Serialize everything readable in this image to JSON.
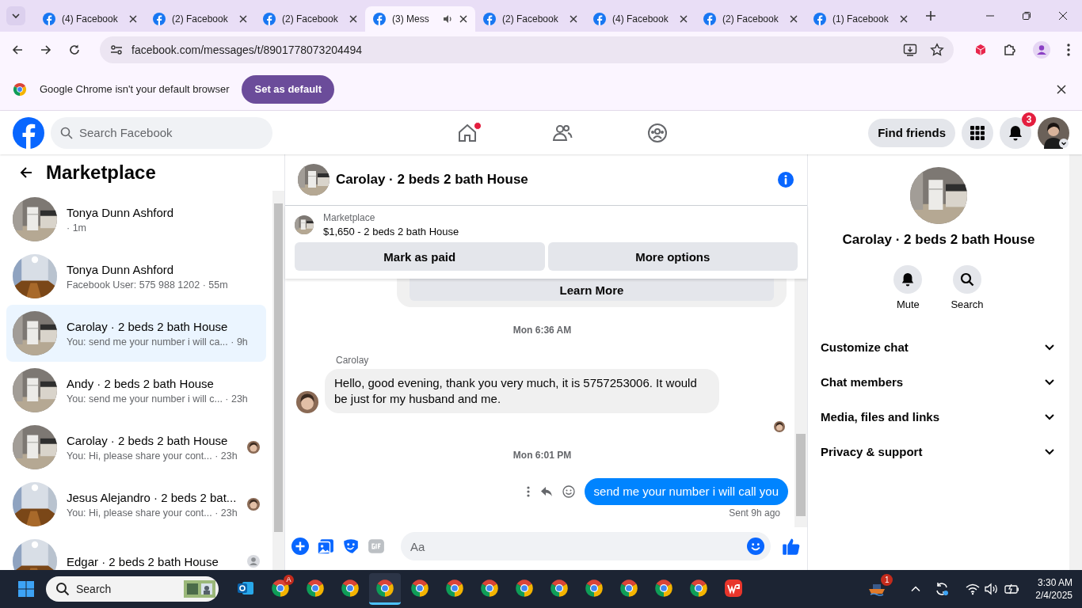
{
  "browser": {
    "tabs": [
      {
        "title": "(4) Facebook",
        "selected": false,
        "audio": false
      },
      {
        "title": "(2) Facebook",
        "selected": false,
        "audio": false
      },
      {
        "title": "(2) Facebook",
        "selected": false,
        "audio": false
      },
      {
        "title": "(3) Mess",
        "selected": true,
        "audio": true
      },
      {
        "title": "(2) Facebook",
        "selected": false,
        "audio": false
      },
      {
        "title": "(4) Facebook",
        "selected": false,
        "audio": false
      },
      {
        "title": "(2) Facebook",
        "selected": false,
        "audio": false
      },
      {
        "title": "(1) Facebook",
        "selected": false,
        "audio": false
      }
    ],
    "url": "facebook.com/messages/t/8901778073204494",
    "infobar": {
      "text": "Google Chrome isn't your default browser",
      "button": "Set as default"
    }
  },
  "header": {
    "search_placeholder": "Search Facebook",
    "nav": [
      {
        "kind": "home",
        "dot": true
      },
      {
        "kind": "friends",
        "dot": false
      },
      {
        "kind": "groups",
        "dot": false
      }
    ],
    "find_friends": "Find friends",
    "notifications": "3"
  },
  "sidebar": {
    "title": "Marketplace",
    "conversations": [
      {
        "name": "Tonya Dunn Ashford",
        "subtitle": "· 1m",
        "selected": false,
        "seen": false
      },
      {
        "name": "Tonya Dunn Ashford",
        "subtitle": "Facebook User: 575 988 1202 · 55m",
        "selected": false,
        "seen": false
      },
      {
        "name": "Carolay · 2 beds 2 bath House",
        "subtitle": "You: send me your number i will ca... · 9h",
        "selected": true,
        "seen": false
      },
      {
        "name": "Andy · 2 beds 2 bath House",
        "subtitle": "You: send me your number i will c... · 23h",
        "selected": false,
        "seen": false
      },
      {
        "name": "Carolay · 2 beds 2 bath House",
        "subtitle": "You: Hi, please share your cont... · 23h",
        "selected": false,
        "seen": true
      },
      {
        "name": "Jesus Alejandro · 2 beds 2 bat...",
        "subtitle": "You: Hi, please share your cont... · 23h",
        "selected": false,
        "seen": true
      },
      {
        "name": "Edgar · 2 beds 2 bath House",
        "selected": false,
        "seen": true
      }
    ]
  },
  "chat": {
    "title": "Carolay · 2 beds 2 bath House",
    "listing": {
      "label": "Marketplace",
      "text": "$1,650 - 2 beds 2 bath House"
    },
    "actions": [
      "Mark as paid",
      "More options"
    ],
    "messages": [
      {
        "kind": "card_button",
        "text": "Learn More"
      },
      {
        "kind": "time",
        "text": "Mon 6:36 AM"
      },
      {
        "kind": "incoming",
        "sender": "Carolay",
        "text": "Hello, good evening, thank you very much, it is 5757253006. It would be just for my husband and me."
      },
      {
        "kind": "read"
      },
      {
        "kind": "time",
        "text": "Mon 6:01 PM"
      },
      {
        "kind": "outgoing",
        "text": "send me your number i will call you",
        "status": "Sent 9h ago"
      }
    ],
    "composer_placeholder": "Aa"
  },
  "details": {
    "name": "Carolay · 2 beds 2 bath House",
    "actions": [
      {
        "kind": "mute",
        "label": "Mute"
      },
      {
        "kind": "search",
        "label": "Search"
      }
    ],
    "sections": [
      {
        "label": "Customize chat",
        "expanded": false
      },
      {
        "label": "Chat members",
        "expanded": false
      },
      {
        "label": "Media, files and links",
        "expanded": false
      },
      {
        "label": "Privacy & support",
        "expanded": false
      }
    ]
  },
  "taskbar": {
    "search_placeholder": "Search",
    "apps": [
      {
        "kind": "mail",
        "selected": false
      },
      {
        "kind": "browser",
        "selected": false,
        "badge": "A"
      },
      {
        "kind": "browser",
        "selected": false
      },
      {
        "kind": "browser",
        "selected": false
      },
      {
        "kind": "browser",
        "selected": true
      },
      {
        "kind": "browser",
        "selected": false
      },
      {
        "kind": "browser",
        "selected": false
      },
      {
        "kind": "browser",
        "selected": false
      },
      {
        "kind": "browser",
        "selected": false
      },
      {
        "kind": "browser",
        "selected": false
      },
      {
        "kind": "browser",
        "selected": false
      },
      {
        "kind": "browser",
        "selected": false
      },
      {
        "kind": "browser",
        "selected": false
      },
      {
        "kind": "browser",
        "selected": false
      },
      {
        "kind": "office",
        "selected": false
      }
    ],
    "tray_badge": "1",
    "time": "3:30 AM",
    "date": "2/4/2025"
  }
}
